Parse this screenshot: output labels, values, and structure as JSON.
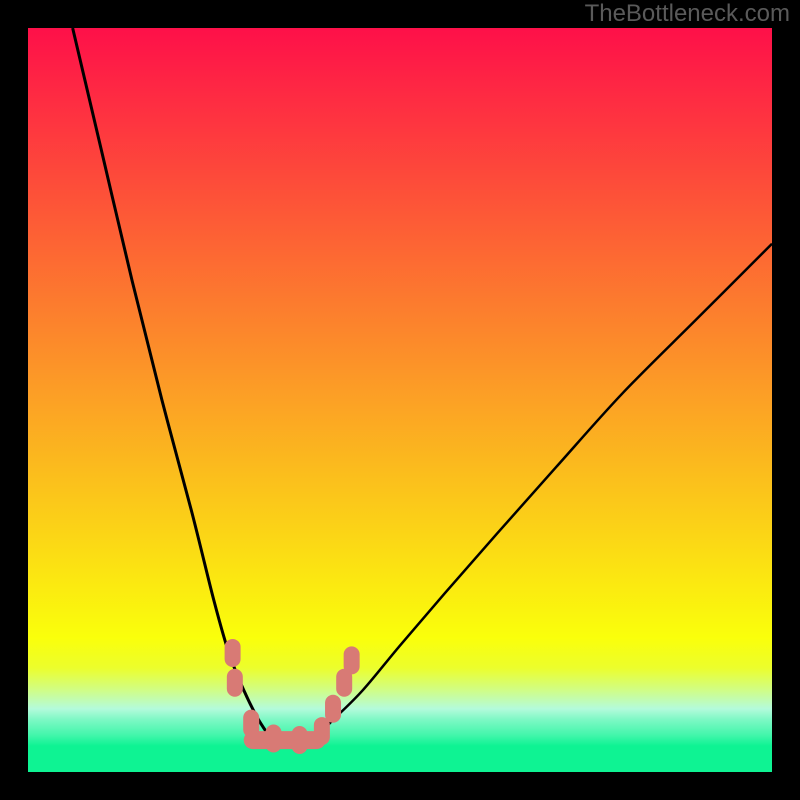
{
  "watermark": "TheBottleneck.com",
  "colors": {
    "frame": "#000000",
    "curve": "#000000",
    "marker_fill": "#d87a75",
    "marker_stroke": "#d87a75",
    "gradient_stops": [
      {
        "offset": 0.0,
        "color": "#fe1049"
      },
      {
        "offset": 0.1,
        "color": "#fe2d42"
      },
      {
        "offset": 0.2,
        "color": "#fd4a3a"
      },
      {
        "offset": 0.3,
        "color": "#fd6733"
      },
      {
        "offset": 0.4,
        "color": "#fc842c"
      },
      {
        "offset": 0.5,
        "color": "#fca125"
      },
      {
        "offset": 0.58,
        "color": "#fbb81e"
      },
      {
        "offset": 0.66,
        "color": "#fbcf18"
      },
      {
        "offset": 0.74,
        "color": "#fbe711"
      },
      {
        "offset": 0.82,
        "color": "#faff0b"
      },
      {
        "offset": 0.86,
        "color": "#ecfe2c"
      },
      {
        "offset": 0.89,
        "color": "#d0fd86"
      },
      {
        "offset": 0.915,
        "color": "#b4fbdb"
      },
      {
        "offset": 0.93,
        "color": "#7cf8c4"
      },
      {
        "offset": 0.95,
        "color": "#44f6ac"
      },
      {
        "offset": 0.965,
        "color": "#0ef393"
      },
      {
        "offset": 1.0,
        "color": "#0ef393"
      }
    ]
  },
  "chart_data": {
    "type": "line",
    "title": "",
    "xlabel": "",
    "ylabel": "",
    "xlim": [
      0,
      100
    ],
    "ylim": [
      0,
      100
    ],
    "note": "Axes are normalized 0–100 (left/bottom = 0). The two curves form a V shape with minimum near x≈35; left branch drops from top-left to bottom, right branch rises from bottom toward upper-right edge. Marker cluster sits near the trough.",
    "series": [
      {
        "name": "left-branch",
        "x": [
          6,
          10,
          14,
          18,
          22,
          25,
          27,
          29,
          31,
          33
        ],
        "y": [
          100,
          83,
          66,
          50,
          35,
          23,
          16,
          11,
          7,
          4
        ]
      },
      {
        "name": "right-branch",
        "x": [
          38,
          41,
          45,
          50,
          56,
          63,
          71,
          80,
          90,
          100
        ],
        "y": [
          4,
          7,
          11,
          17,
          24,
          32,
          41,
          51,
          61,
          71
        ]
      }
    ],
    "markers": {
      "name": "highlighted-points",
      "shape": "rounded-capsule",
      "color": "#d87a75",
      "points_xy": [
        [
          27.5,
          16
        ],
        [
          27.8,
          12
        ],
        [
          30.0,
          6.5
        ],
        [
          33.0,
          4.5
        ],
        [
          36.5,
          4.3
        ],
        [
          39.5,
          5.5
        ],
        [
          41.0,
          8.5
        ],
        [
          42.5,
          12
        ],
        [
          43.5,
          15
        ]
      ]
    }
  }
}
